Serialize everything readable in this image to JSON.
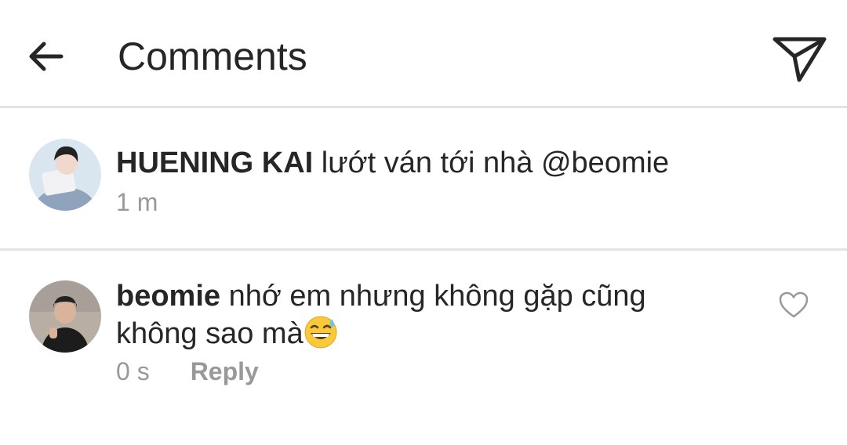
{
  "header": {
    "title": "Comments",
    "back_icon": "arrow-left-icon",
    "send_icon": "paper-plane-icon"
  },
  "caption": {
    "username": "HUENING KAI",
    "text": "lướt ván tới nhà @beomie",
    "time": "1 m"
  },
  "comments": [
    {
      "username": "beomie",
      "text_line1": "nhớ em nhưng không gặp cũng",
      "text_line2": "không sao mà",
      "emoji": "grinning-face-with-sweat-emoji",
      "time": "0 s",
      "reply_label": "Reply",
      "like_icon": "heart-outline-icon"
    }
  ],
  "colors": {
    "text": "#262626",
    "muted": "#999999",
    "divider": "#e3e3e3"
  }
}
